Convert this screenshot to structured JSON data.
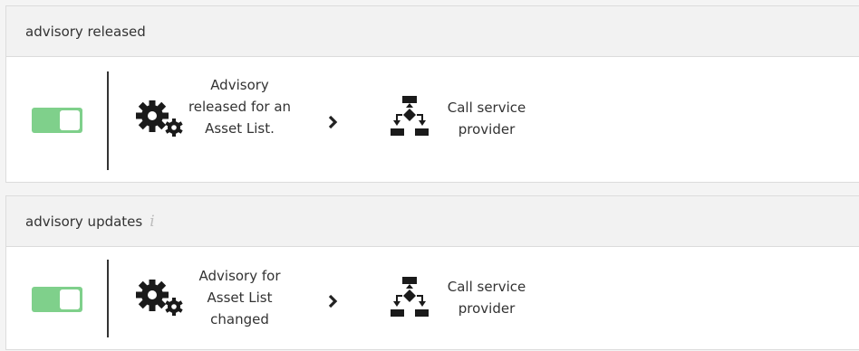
{
  "rules": [
    {
      "title": "advisory released",
      "show_info": false,
      "enabled": true,
      "trigger_icon": "gears-icon",
      "trigger_label": "Advisory released for an Asset List.",
      "arrow_icon": "chevron-right-icon",
      "action_icon": "workflow-icon",
      "action_label": "Call service provider"
    },
    {
      "title": "advisory updates",
      "show_info": true,
      "info_icon": "info-icon",
      "enabled": true,
      "trigger_icon": "gears-icon",
      "trigger_label": "Advisory for Asset List changed",
      "arrow_icon": "chevron-right-icon",
      "action_icon": "workflow-icon",
      "action_label": "Call service provider"
    }
  ],
  "colors": {
    "toggle_on": "#7fd08b",
    "header_bg": "#f2f2f2",
    "page_bg": "#f4f4f4",
    "icon": "#1a1a1a"
  },
  "info_glyph": "i"
}
